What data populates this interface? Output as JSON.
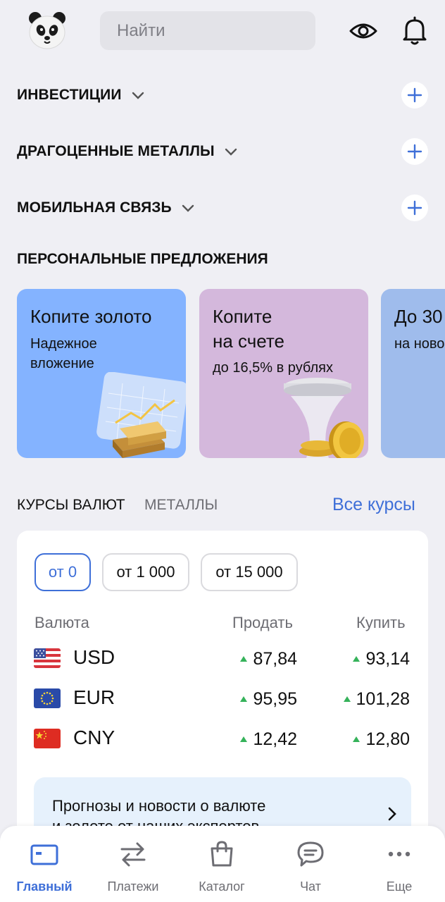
{
  "header": {
    "search_placeholder": "Найти",
    "icons": [
      "panda-avatar-icon",
      "eye-icon",
      "bell-icon"
    ]
  },
  "sections": [
    {
      "title": "ИНВЕСТИЦИИ"
    },
    {
      "title": "ДРАГОЦЕННЫЕ МЕТАЛЛЫ"
    },
    {
      "title": "МОБИЛЬНАЯ СВЯЗЬ"
    }
  ],
  "personal_offers": {
    "title": "ПЕРСОНАЛЬНЫЕ ПРЕДЛОЖЕНИЯ",
    "cards": [
      {
        "title": "Копите золото",
        "subtitle_line1": "Надежное",
        "subtitle_line2": "вложение",
        "color": "#84b3ff"
      },
      {
        "title_line1": "Копите",
        "title_line2": "на счете",
        "subtitle": "до 16,5% в рублях",
        "color": "#d4b8dc"
      },
      {
        "title": "До 30",
        "subtitle": "на ново",
        "color": "#9fbcec"
      }
    ]
  },
  "rates": {
    "tabs": [
      {
        "label": "КУРСЫ ВАЛЮТ",
        "active": true
      },
      {
        "label": "МЕТАЛЛЫ",
        "active": false
      }
    ],
    "all_rates_link": "Все курсы",
    "amount_chips": [
      {
        "label": "от 0",
        "active": true
      },
      {
        "label": "от 1 000",
        "active": false
      },
      {
        "label": "от 15 000",
        "active": false
      }
    ],
    "columns": {
      "currency": "Валюта",
      "sell": "Продать",
      "buy": "Купить"
    },
    "rows": [
      {
        "code": "USD",
        "flag": "us-flag-icon",
        "sell": "87,84",
        "buy": "93,14"
      },
      {
        "code": "EUR",
        "flag": "eu-flag-icon",
        "sell": "95,95",
        "buy": "101,28"
      },
      {
        "code": "CNY",
        "flag": "cn-flag-icon",
        "sell": "12,42",
        "buy": "12,80"
      }
    ],
    "news_banner": {
      "line1": "Прогнозы и новости о валюте",
      "line2": "и золоте от наших экспертов"
    }
  },
  "bottom_nav": [
    {
      "label": "Главный",
      "icon": "card-icon",
      "active": true
    },
    {
      "label": "Платежи",
      "icon": "transfer-arrows-icon",
      "active": false
    },
    {
      "label": "Каталог",
      "icon": "shopping-bag-icon",
      "active": false
    },
    {
      "label": "Чат",
      "icon": "chat-icon",
      "active": false
    },
    {
      "label": "Еще",
      "icon": "more-dots-icon",
      "active": false
    }
  ],
  "colors": {
    "accent": "#3e6fd8",
    "background": "#efeff4",
    "up_arrow": "#35b25a"
  }
}
